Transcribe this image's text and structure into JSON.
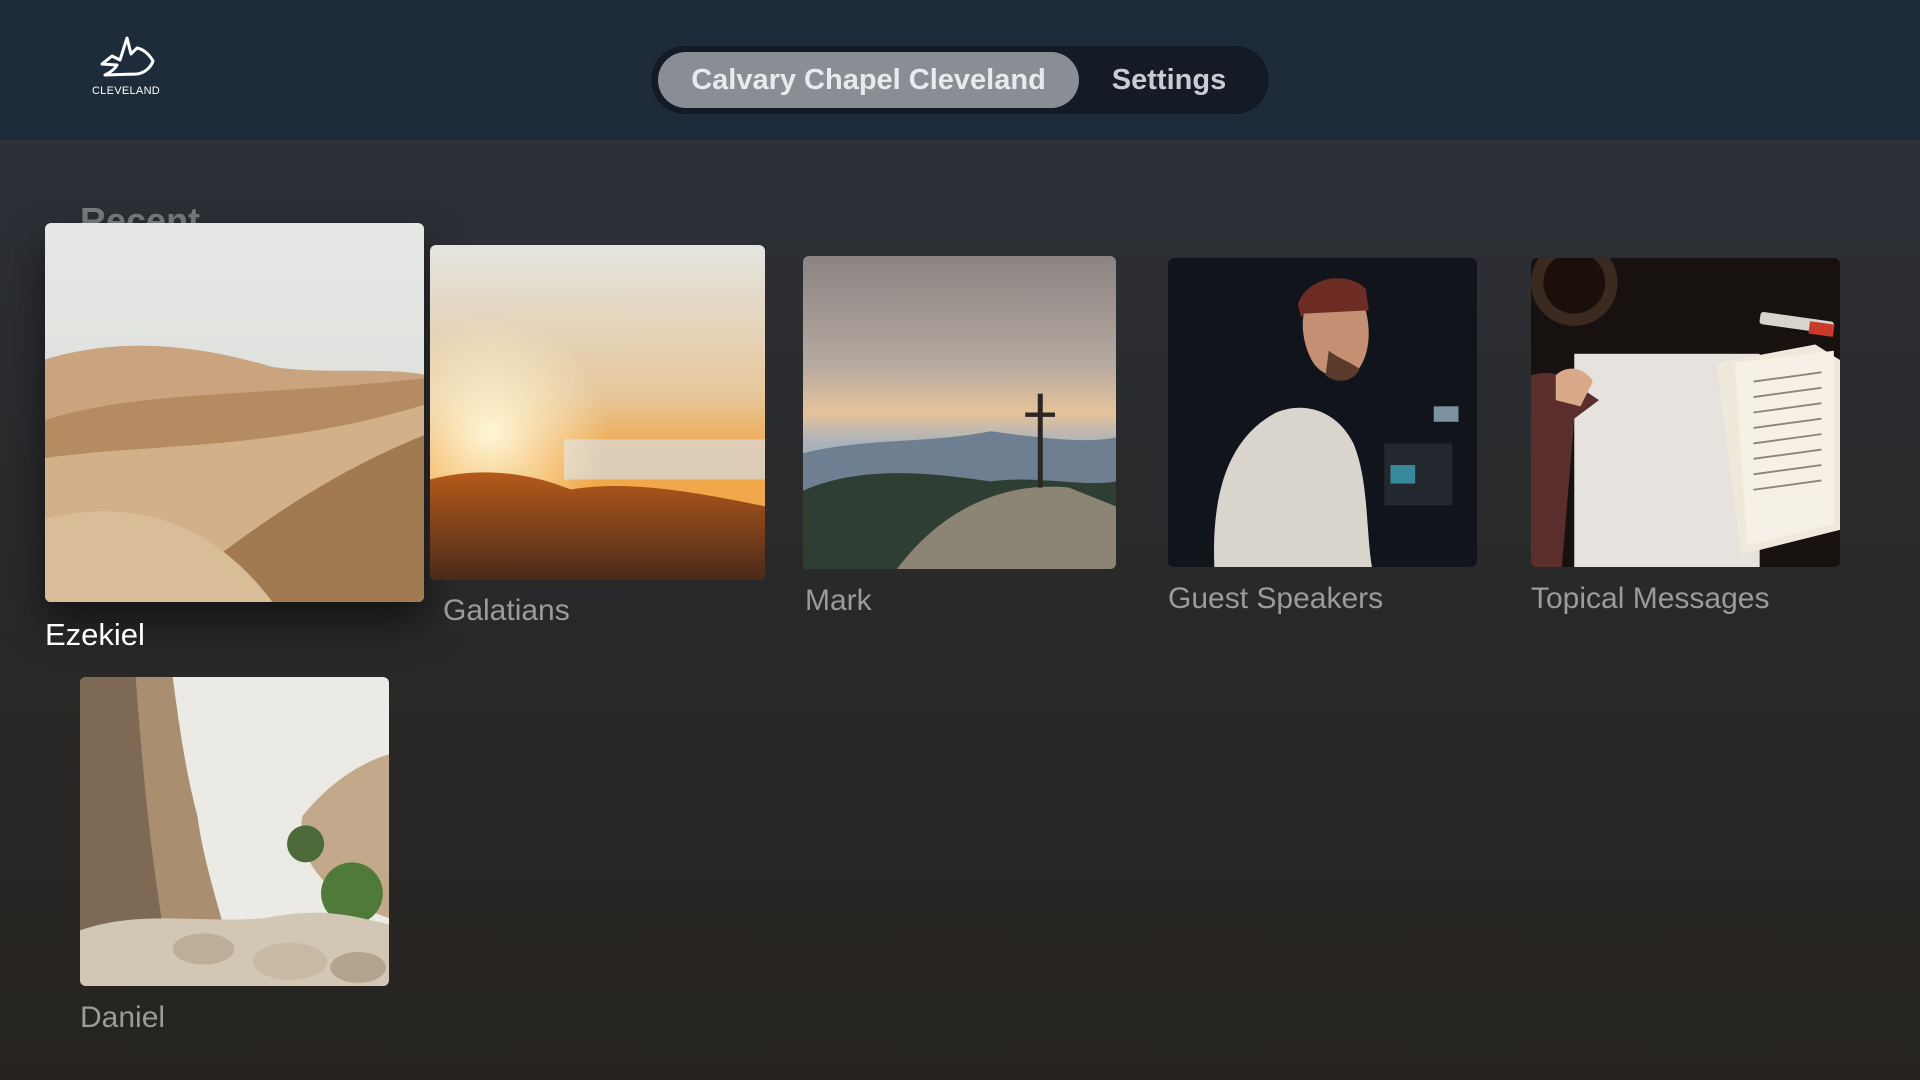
{
  "header": {
    "logo_text": "CLEVELAND",
    "tabs": [
      {
        "label": "Calvary Chapel Cleveland",
        "active": true
      },
      {
        "label": "Settings",
        "active": false
      }
    ]
  },
  "section": {
    "title": "Recent"
  },
  "tiles": [
    {
      "label": "Ezekiel",
      "image": "desert-dunes",
      "focused": true
    },
    {
      "label": "Galatians",
      "image": "sunrise-over-mountains",
      "focused": false
    },
    {
      "label": "Mark",
      "image": "cross-on-mountain",
      "focused": false
    },
    {
      "label": "Guest Speakers",
      "image": "man-with-camera",
      "focused": false
    },
    {
      "label": "Topical Messages",
      "image": "open-bible-and-notebook",
      "focused": false
    },
    {
      "label": "Daniel",
      "image": "rocky-canyon",
      "focused": false
    }
  ],
  "colors": {
    "header_bg": "#1e2b3b",
    "tab_bar_bg": "#141b26",
    "active_tab_bg": "#8a8e94",
    "focused_label": "#ffffff",
    "label": "#9b9b9c"
  }
}
